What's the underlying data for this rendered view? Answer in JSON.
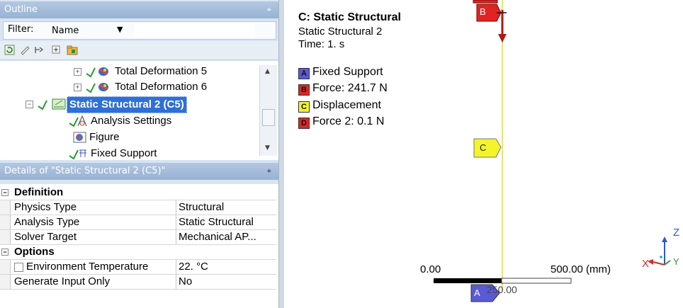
{
  "outline": {
    "title": "Outline",
    "pin": "⌖",
    "filter_label": "Filter:",
    "filter_value": "Name",
    "tree": [
      {
        "label": "Total Deformation 5",
        "level": 3,
        "expander": "+"
      },
      {
        "label": "Total Deformation 6",
        "level": 3,
        "expander": "+"
      },
      {
        "label": "Static Structural 2 (C5)",
        "level": 2,
        "expander": "−",
        "selected": true
      },
      {
        "label": "Analysis Settings",
        "level": 3
      },
      {
        "label": "Figure",
        "level": 3
      },
      {
        "label": "Fixed Support",
        "level": 3
      }
    ]
  },
  "details": {
    "title": "Details of \"Static Structural 2 (C5)\"",
    "pin": "⌖",
    "groups": [
      {
        "name": "Definition",
        "rows": [
          {
            "key": "Physics Type",
            "value": "Structural"
          },
          {
            "key": "Analysis Type",
            "value": "Static Structural"
          },
          {
            "key": "Solver Target",
            "value": "Mechanical AP..."
          }
        ]
      },
      {
        "name": "Options",
        "rows": [
          {
            "key": "Environment Temperature",
            "value": "22. °C",
            "checkbox": true
          },
          {
            "key": "Generate Input Only",
            "value": "No"
          }
        ]
      }
    ]
  },
  "viewport": {
    "heading": "C: Static Structural",
    "subtitle": "Static Structural 2",
    "time": "Time: 1. s",
    "legend": [
      {
        "letter": "A",
        "label": "Fixed Support",
        "color": "#5a5ad6"
      },
      {
        "letter": "B",
        "label": "Force: 241.7 N",
        "color": "#e02424"
      },
      {
        "letter": "C",
        "label": "Displacement",
        "color": "#f4f42a"
      },
      {
        "letter": "D",
        "label": "Force 2: 0.1 N",
        "color": "#e02424"
      }
    ],
    "scale": {
      "left": "0.00",
      "right": "500.00 (mm)",
      "mid": "250.00"
    },
    "tags": {
      "a": "A",
      "b": "B",
      "c": "C"
    },
    "triad": {
      "z": "Z",
      "x": "X",
      "y": "Y"
    }
  }
}
